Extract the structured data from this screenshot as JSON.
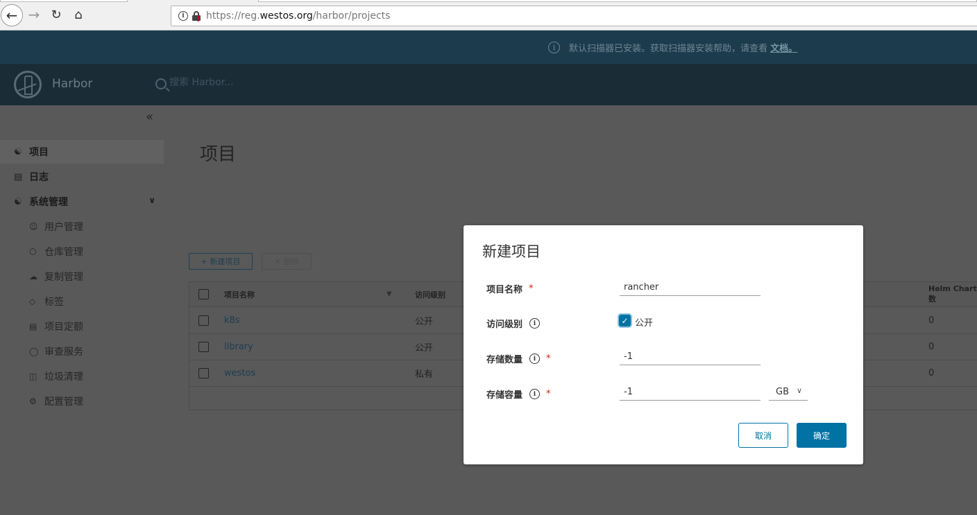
{
  "browser": {
    "url_prefix": "https://reg.",
    "url_host": "westos.org",
    "url_path": "/harbor/projects",
    "back_icon": "arrow-left",
    "forward_icon": "arrow-right",
    "reload_icon": "reload",
    "home_icon": "home"
  },
  "banner": {
    "text": "默认扫描器已安装。获取扫描器安装帮助，请查看",
    "link": "文档。"
  },
  "header": {
    "brand": "Harbor",
    "search_placeholder": "搜索 Harbor..."
  },
  "sidebar": {
    "items": [
      {
        "label": "项目",
        "icon": "projects-icon",
        "active": true
      },
      {
        "label": "日志",
        "icon": "logs-icon"
      },
      {
        "label": "系统管理",
        "icon": "admin-icon"
      }
    ],
    "sub_items": [
      {
        "label": "用户管理",
        "icon": "users-icon"
      },
      {
        "label": "仓库管理",
        "icon": "registry-icon"
      },
      {
        "label": "复制管理",
        "icon": "replication-icon"
      },
      {
        "label": "标签",
        "icon": "tag-icon"
      },
      {
        "label": "项目定额",
        "icon": "quota-icon"
      },
      {
        "label": "审查服务",
        "icon": "shield-icon"
      },
      {
        "label": "垃圾清理",
        "icon": "trash-icon"
      },
      {
        "label": "配置管理",
        "icon": "gear-icon"
      }
    ]
  },
  "main": {
    "title": "项目",
    "new_project_label": "新建项目",
    "delete_label": "删除",
    "table": {
      "columns": [
        "项目名称",
        "访问级别",
        "Helm Chart 数"
      ],
      "rows": [
        {
          "name": "k8s",
          "level": "公开",
          "helm": "0"
        },
        {
          "name": "library",
          "level": "公开",
          "helm": "0"
        },
        {
          "name": "westos",
          "level": "私有",
          "helm": "0"
        }
      ]
    }
  },
  "modal": {
    "title": "新建项目",
    "name_label": "项目名称",
    "name_value": "rancher",
    "access_label": "访问级别",
    "public_checked": true,
    "public_label": "公开",
    "count_label": "存储数量",
    "count_value": "-1",
    "capacity_label": "存储容量",
    "capacity_value": "-1",
    "capacity_unit": "GB",
    "required_mark": "*",
    "cancel_label": "取消",
    "ok_label": "确定"
  },
  "colors": {
    "primary": "#0072a3",
    "banner_bg": "#1c3c4e",
    "header_bg": "#1a2d36",
    "required": "#c92100"
  }
}
